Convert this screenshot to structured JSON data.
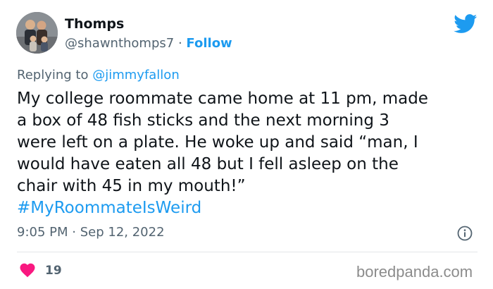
{
  "author": {
    "name": "Thomps",
    "handle": "@shawnthomps7",
    "separator": "·",
    "follow_label": "Follow"
  },
  "platform_icon": "twitter-bird-icon",
  "reply": {
    "prefix": "Replying to",
    "mention": "@jimmyfallon"
  },
  "tweet": {
    "lines": [
      "My college roommate came home at 11 pm, made",
      "a box of 48 fish sticks and the next morning 3",
      "were left on a plate. He woke up and said “man, I",
      "would have eaten all 48 but I fell asleep on the",
      "chair with 45 in my mouth!”"
    ],
    "hashtag": "#MyRoommateIsWeird"
  },
  "meta": {
    "time": "9:05 PM",
    "separator": "·",
    "date": "Sep 12, 2022",
    "info_icon": "info-icon"
  },
  "engagement": {
    "like_icon": "heart-icon",
    "likes": "19"
  },
  "watermark": "boredpanda.com",
  "colors": {
    "accent": "#1d9bf0",
    "like": "#f91880",
    "text": "#0f1419",
    "muted": "#536471"
  }
}
